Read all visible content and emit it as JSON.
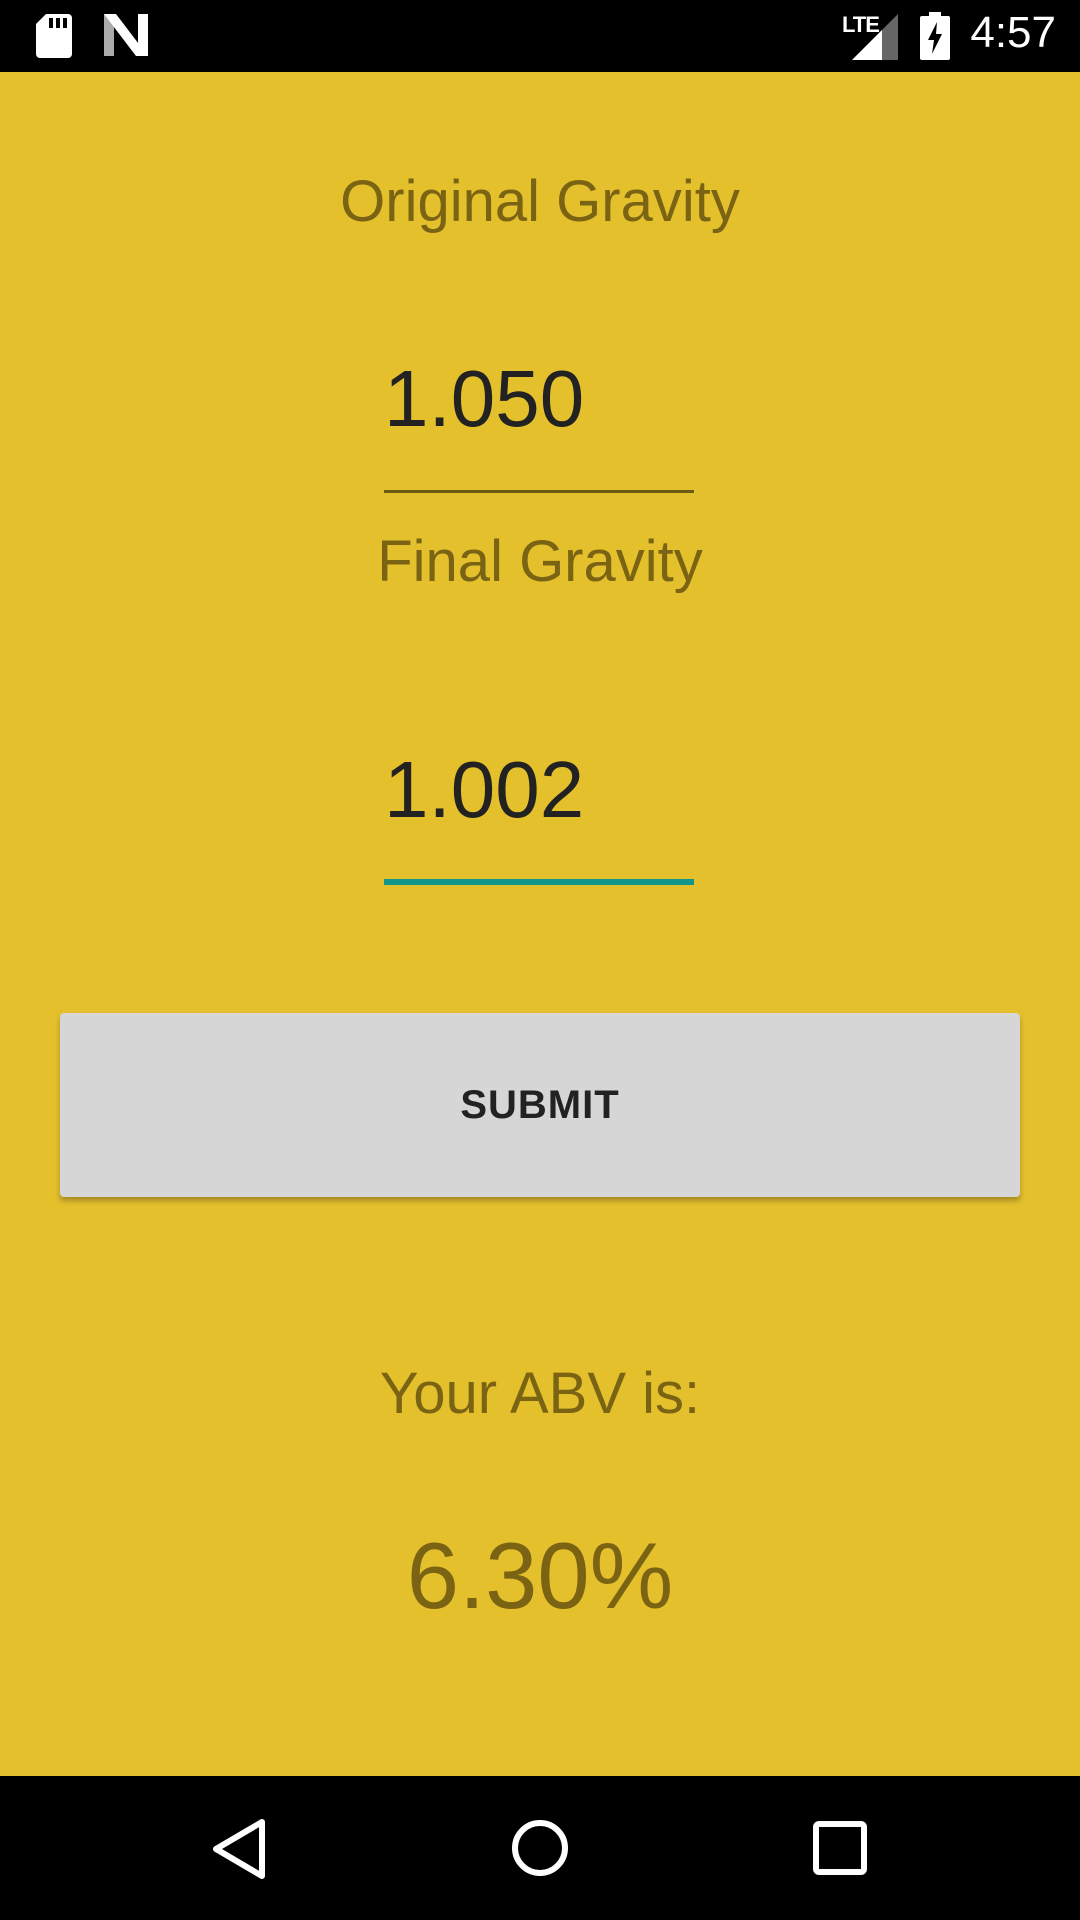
{
  "status_bar": {
    "network_label": "LTE",
    "time": "4:57",
    "icons": [
      "sd-card-icon",
      "n-logo-icon",
      "signal-icon",
      "battery-charging-icon"
    ]
  },
  "form": {
    "original_gravity_label": "Original Gravity",
    "original_gravity_value": "1.050",
    "final_gravity_label": "Final Gravity",
    "final_gravity_value": "1.002",
    "submit_label": "SUBMIT"
  },
  "result": {
    "label": "Your ABV is:",
    "value": "6.30%"
  },
  "nav_bar": {
    "icons": [
      "back-icon",
      "home-icon",
      "recents-icon"
    ]
  },
  "colors": {
    "background": "#E5C02D",
    "label_text": "#7A6413",
    "focused_underline": "#13968A",
    "button": "#D6D6D6"
  }
}
